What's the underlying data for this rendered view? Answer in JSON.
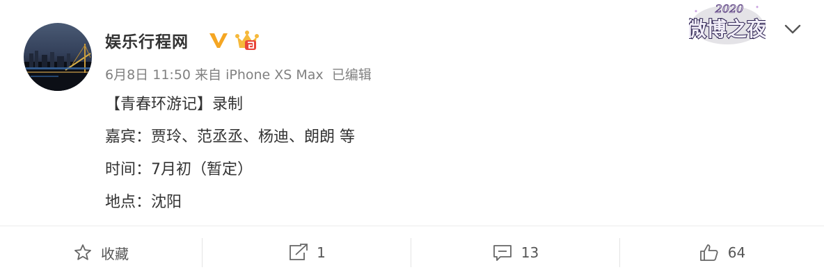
{
  "user": {
    "name": "娱乐行程网",
    "verified_icon": "verified-v-icon",
    "member_icon": "vip-crown-icon"
  },
  "meta": {
    "date": "6月8日",
    "time": "11:50",
    "source": "来自 iPhone XS Max",
    "edited": "已编辑"
  },
  "post": {
    "lines": [
      "【青春环游记】录制",
      "嘉宾：贾玲、范丞丞、杨迪、朗朗 等",
      "时间：7月初（暂定）",
      "地点：沈阳"
    ]
  },
  "promo": {
    "year": "2020",
    "title": "微博之夜"
  },
  "actions": {
    "favorite_label": "收藏",
    "repost_count": "1",
    "comment_count": "13",
    "like_count": "64"
  },
  "colors": {
    "text": "#333333",
    "meta": "#808080",
    "verified": "#f5a623",
    "crown": "#e8443a"
  }
}
